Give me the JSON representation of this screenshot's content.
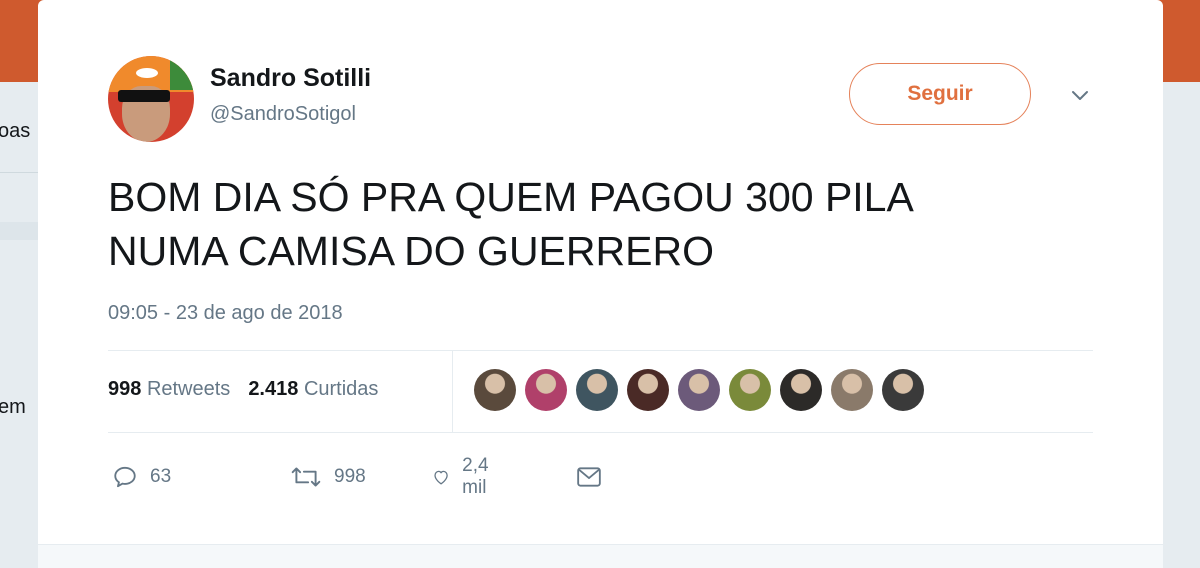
{
  "background": {
    "left_text_top": "oas",
    "left_text_bottom": "em"
  },
  "tweet": {
    "author_name": "Sandro Sotilli",
    "author_handle": "@SandroSotigol",
    "follow_label": "Seguir",
    "text_lines": [
      "BOM DIA SÓ PRA QUEM PAGOU 300 PILA",
      "NUMA CAMISA DO GUERRERO"
    ],
    "timestamp": "09:05 - 23 de ago de 2018",
    "retweets_count": "998",
    "retweets_label": "Retweets",
    "likes_count": "2.418",
    "likes_label": "Curtidas",
    "likers": [
      {
        "icon": "liker-avatar",
        "color": "#5a4a3c"
      },
      {
        "icon": "liker-avatar",
        "color": "#b0406a"
      },
      {
        "icon": "liker-avatar",
        "color": "#3f5560"
      },
      {
        "icon": "liker-avatar",
        "color": "#4a2a26"
      },
      {
        "icon": "liker-avatar",
        "color": "#6c5a7a"
      },
      {
        "icon": "liker-avatar",
        "color": "#7a8a3a"
      },
      {
        "icon": "liker-avatar",
        "color": "#2c2a28"
      },
      {
        "icon": "liker-avatar",
        "color": "#8a7a6a"
      },
      {
        "icon": "liker-avatar",
        "color": "#3a3a3a"
      }
    ],
    "actions": {
      "reply_count": "63",
      "retweet_count": "998",
      "like_count": "2,4 mil"
    }
  },
  "colors": {
    "accent": "#e0703f",
    "topbar": "#cf5a2e",
    "text": "#14171a",
    "muted": "#657786"
  }
}
